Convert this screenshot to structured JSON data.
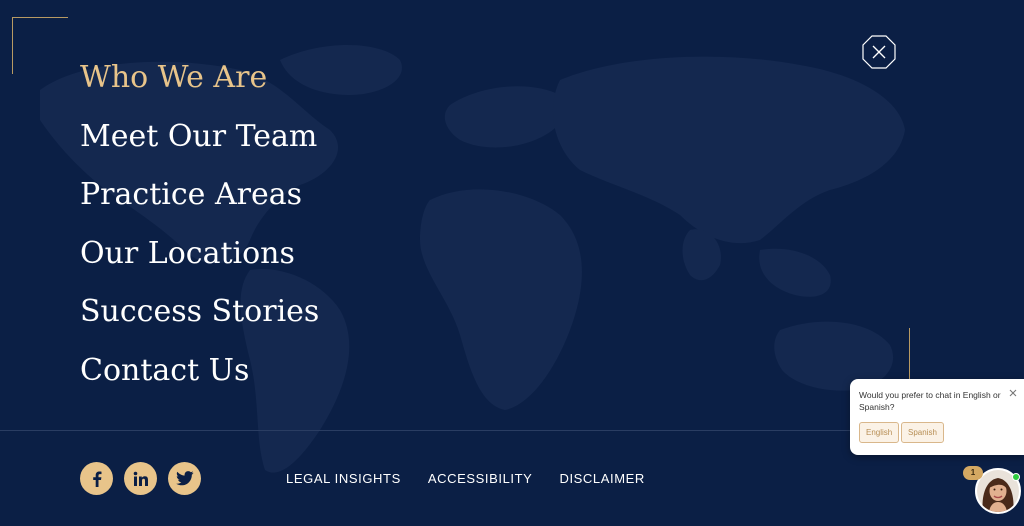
{
  "nav": {
    "items": [
      {
        "label": "Who We Are",
        "active": true
      },
      {
        "label": "Meet Our Team",
        "active": false
      },
      {
        "label": "Practice Areas",
        "active": false
      },
      {
        "label": "Our Locations",
        "active": false
      },
      {
        "label": "Success Stories",
        "active": false
      },
      {
        "label": "Contact Us",
        "active": false
      }
    ]
  },
  "close_icon": "close-x-octagon-icon",
  "social": [
    {
      "icon": "facebook-icon"
    },
    {
      "icon": "linkedin-icon"
    },
    {
      "icon": "twitter-icon"
    }
  ],
  "footer_links": [
    "LEGAL INSIGHTS",
    "ACCESSIBILITY",
    "DISCLAIMER"
  ],
  "chat": {
    "question": "Would you prefer to chat in English or Spanish?",
    "options": [
      "English",
      "Spanish"
    ],
    "badge_count": "1"
  },
  "colors": {
    "background": "#0b1f45",
    "accent_gold": "#e8c48a",
    "text": "#ffffff"
  }
}
